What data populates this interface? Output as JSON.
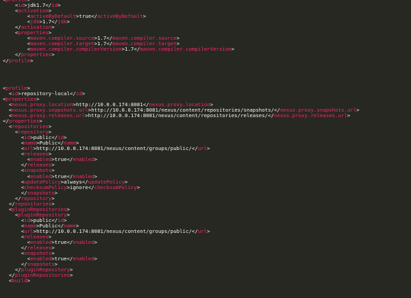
{
  "colors": {
    "background": "#272822",
    "tag": "#f92672",
    "text": "#f8f8f2"
  },
  "lines": [
    [
      0,
      [
        [
          "p",
          "<"
        ],
        [
          "t",
          "profile"
        ],
        [
          "p",
          ">"
        ]
      ]
    ],
    [
      4,
      [
        [
          "p",
          "<"
        ],
        [
          "t",
          "id"
        ],
        [
          "p",
          ">"
        ],
        [
          "x",
          "jdk1.7"
        ],
        [
          "p",
          "</"
        ],
        [
          "t",
          "id"
        ],
        [
          "p",
          ">"
        ]
      ]
    ],
    [
      4,
      [
        [
          "p",
          "<"
        ],
        [
          "t",
          "activation"
        ],
        [
          "p",
          ">"
        ]
      ]
    ],
    [
      8,
      [
        [
          "p",
          "<"
        ],
        [
          "t",
          "activeByDefault"
        ],
        [
          "p",
          ">"
        ],
        [
          "x",
          "true"
        ],
        [
          "p",
          "</"
        ],
        [
          "t",
          "activeByDefault"
        ],
        [
          "p",
          ">"
        ]
      ]
    ],
    [
      8,
      [
        [
          "p",
          "<"
        ],
        [
          "t",
          "jdk"
        ],
        [
          "p",
          ">"
        ],
        [
          "x",
          "1.7"
        ],
        [
          "p",
          "</"
        ],
        [
          "t",
          "jdk"
        ],
        [
          "p",
          ">"
        ]
      ]
    ],
    [
      4,
      [
        [
          "p",
          "</"
        ],
        [
          "t",
          "activation"
        ],
        [
          "p",
          ">"
        ]
      ]
    ],
    [
      4,
      [
        [
          "p",
          "<"
        ],
        [
          "t",
          "properties"
        ],
        [
          "p",
          ">"
        ]
      ]
    ],
    [
      8,
      [
        [
          "p",
          "<"
        ],
        [
          "t",
          "maven.compiler.source"
        ],
        [
          "p",
          ">"
        ],
        [
          "x",
          "1.7"
        ],
        [
          "p",
          "</"
        ],
        [
          "t",
          "maven.compiler.source"
        ],
        [
          "p",
          ">"
        ]
      ]
    ],
    [
      8,
      [
        [
          "p",
          "<"
        ],
        [
          "t",
          "maven.compiler.target"
        ],
        [
          "p",
          ">"
        ],
        [
          "x",
          "1.7"
        ],
        [
          "p",
          "</"
        ],
        [
          "t",
          "maven.compiler.target"
        ],
        [
          "p",
          ">"
        ]
      ]
    ],
    [
      8,
      [
        [
          "p",
          "<"
        ],
        [
          "t",
          "maven.compiler.compilerVersion"
        ],
        [
          "p",
          ">"
        ],
        [
          "x",
          "1.7"
        ],
        [
          "p",
          "</"
        ],
        [
          "t",
          "maven.compiler.compilerVersion"
        ],
        [
          "p",
          ">"
        ]
      ]
    ],
    [
      4,
      [
        [
          "p",
          "</"
        ],
        [
          "t",
          "properties"
        ],
        [
          "p",
          ">"
        ]
      ]
    ],
    [
      0,
      [
        [
          "p",
          "</"
        ],
        [
          "t",
          "profile"
        ],
        [
          "p",
          ">"
        ]
      ]
    ],
    [
      0,
      []
    ],
    [
      0,
      []
    ],
    [
      0,
      []
    ],
    [
      0,
      []
    ],
    [
      0,
      [
        [
          "p",
          "<"
        ],
        [
          "t",
          "profile"
        ],
        [
          "p",
          ">"
        ]
      ]
    ],
    [
      2,
      [
        [
          "p",
          "<"
        ],
        [
          "t",
          "id"
        ],
        [
          "p",
          ">"
        ],
        [
          "x",
          "repository-local"
        ],
        [
          "p",
          "</"
        ],
        [
          "t",
          "id"
        ],
        [
          "p",
          ">"
        ]
      ]
    ],
    [
      0,
      [
        [
          "p",
          "<"
        ],
        [
          "t",
          "properties"
        ],
        [
          "p",
          ">"
        ]
      ]
    ],
    [
      2,
      [
        [
          "p",
          "<"
        ],
        [
          "t",
          "nexus.proxy.location"
        ],
        [
          "p",
          ">"
        ],
        [
          "x",
          "http://10.0.0.174:8081"
        ],
        [
          "p",
          "</"
        ],
        [
          "t",
          "nexus.proxy.location"
        ],
        [
          "p",
          ">"
        ]
      ]
    ],
    [
      2,
      [
        [
          "p",
          "<"
        ],
        [
          "t",
          "nexus.proxy.snapshots.url"
        ],
        [
          "p",
          ">"
        ],
        [
          "x",
          "http://10.0.0.174:8081/nexus/content/repositories/snapshots/"
        ],
        [
          "p",
          "</"
        ],
        [
          "t",
          "nexus.proxy.snapshots.url"
        ],
        [
          "p",
          ">"
        ]
      ]
    ],
    [
      2,
      [
        [
          "p",
          "<"
        ],
        [
          "t",
          "nexus.proxy.releases.url"
        ],
        [
          "p",
          ">"
        ],
        [
          "x",
          "http://10.0.0.174:8081/nexus/content/repositories/releases/"
        ],
        [
          "p",
          "</"
        ],
        [
          "t",
          "nexus.proxy.releases.url"
        ],
        [
          "p",
          ">"
        ]
      ]
    ],
    [
      0,
      [
        [
          "p",
          "</"
        ],
        [
          "t",
          "properties"
        ],
        [
          "p",
          ">"
        ]
      ]
    ],
    [
      2,
      [
        [
          "p",
          "<"
        ],
        [
          "t",
          "repositories"
        ],
        [
          "p",
          ">"
        ]
      ]
    ],
    [
      4,
      [
        [
          "p",
          "<"
        ],
        [
          "t",
          "repository"
        ],
        [
          "p",
          ">"
        ]
      ]
    ],
    [
      6,
      [
        [
          "p",
          "<"
        ],
        [
          "t",
          "id"
        ],
        [
          "p",
          ">"
        ],
        [
          "x",
          "public"
        ],
        [
          "p",
          "</"
        ],
        [
          "t",
          "id"
        ],
        [
          "p",
          ">"
        ]
      ]
    ],
    [
      6,
      [
        [
          "p",
          "<"
        ],
        [
          "t",
          "name"
        ],
        [
          "p",
          ">"
        ],
        [
          "x",
          "Public"
        ],
        [
          "p",
          "</"
        ],
        [
          "t",
          "name"
        ],
        [
          "p",
          ">"
        ]
      ]
    ],
    [
      6,
      [
        [
          "p",
          "<"
        ],
        [
          "t",
          "url"
        ],
        [
          "p",
          ">"
        ],
        [
          "x",
          "http://10.0.0.174:8081/nexus/content/groups/public/"
        ],
        [
          "p",
          "</"
        ],
        [
          "t",
          "url"
        ],
        [
          "p",
          ">"
        ]
      ]
    ],
    [
      6,
      [
        [
          "p",
          "<"
        ],
        [
          "t",
          "releases"
        ],
        [
          "p",
          ">"
        ]
      ]
    ],
    [
      8,
      [
        [
          "p",
          "<"
        ],
        [
          "t",
          "enabled"
        ],
        [
          "p",
          ">"
        ],
        [
          "x",
          "true"
        ],
        [
          "p",
          "</"
        ],
        [
          "t",
          "enabled"
        ],
        [
          "p",
          ">"
        ]
      ]
    ],
    [
      6,
      [
        [
          "p",
          "</"
        ],
        [
          "t",
          "releases"
        ],
        [
          "p",
          ">"
        ]
      ]
    ],
    [
      6,
      [
        [
          "p",
          "<"
        ],
        [
          "t",
          "snapshots"
        ],
        [
          "p",
          ">"
        ]
      ]
    ],
    [
      8,
      [
        [
          "p",
          "<"
        ],
        [
          "t",
          "enabled"
        ],
        [
          "p",
          ">"
        ],
        [
          "x",
          "true"
        ],
        [
          "p",
          "</"
        ],
        [
          "t",
          "enabled"
        ],
        [
          "p",
          ">"
        ]
      ]
    ],
    [
      6,
      [
        [
          "p",
          "<"
        ],
        [
          "t",
          "updatePolicy"
        ],
        [
          "p",
          ">"
        ],
        [
          "x",
          "always"
        ],
        [
          "p",
          "</"
        ],
        [
          "t",
          "updatePolicy"
        ],
        [
          "p",
          ">"
        ]
      ]
    ],
    [
      6,
      [
        [
          "p",
          "<"
        ],
        [
          "t",
          "checksumPolicy"
        ],
        [
          "p",
          ">"
        ],
        [
          "x",
          "ignore"
        ],
        [
          "p",
          "</"
        ],
        [
          "t",
          "checksumPolicy"
        ],
        [
          "p",
          ">"
        ]
      ]
    ],
    [
      6,
      [
        [
          "p",
          "</"
        ],
        [
          "t",
          "snapshots"
        ],
        [
          "p",
          ">"
        ]
      ]
    ],
    [
      4,
      [
        [
          "p",
          "</"
        ],
        [
          "t",
          "repository"
        ],
        [
          "p",
          ">"
        ]
      ]
    ],
    [
      2,
      [
        [
          "p",
          "</"
        ],
        [
          "t",
          "repositories"
        ],
        [
          "p",
          ">"
        ]
      ]
    ],
    [
      2,
      [
        [
          "p",
          "<"
        ],
        [
          "t",
          "pluginRepositories"
        ],
        [
          "p",
          ">"
        ]
      ]
    ],
    [
      4,
      [
        [
          "p",
          "<"
        ],
        [
          "t",
          "pluginRepository"
        ],
        [
          "p",
          ">"
        ]
      ]
    ],
    [
      6,
      [
        [
          "p",
          "<"
        ],
        [
          "t",
          "id"
        ],
        [
          "p",
          ">"
        ],
        [
          "x",
          "public"
        ],
        [
          "p",
          "</"
        ],
        [
          "t",
          "id"
        ],
        [
          "p",
          ">"
        ]
      ]
    ],
    [
      6,
      [
        [
          "p",
          "<"
        ],
        [
          "t",
          "name"
        ],
        [
          "p",
          ">"
        ],
        [
          "x",
          "Public"
        ],
        [
          "p",
          "</"
        ],
        [
          "t",
          "name"
        ],
        [
          "p",
          ">"
        ]
      ]
    ],
    [
      6,
      [
        [
          "p",
          "<"
        ],
        [
          "t",
          "url"
        ],
        [
          "p",
          ">"
        ],
        [
          "x",
          "http://10.0.0.174:8081/nexus/content/groups/public/"
        ],
        [
          "p",
          "</"
        ],
        [
          "t",
          "url"
        ],
        [
          "p",
          ">"
        ]
      ]
    ],
    [
      6,
      [
        [
          "p",
          "<"
        ],
        [
          "t",
          "releases"
        ],
        [
          "p",
          ">"
        ]
      ]
    ],
    [
      8,
      [
        [
          "p",
          "<"
        ],
        [
          "t",
          "enabled"
        ],
        [
          "p",
          ">"
        ],
        [
          "x",
          "true"
        ],
        [
          "p",
          "</"
        ],
        [
          "t",
          "enabled"
        ],
        [
          "p",
          ">"
        ]
      ]
    ],
    [
      6,
      [
        [
          "p",
          "</"
        ],
        [
          "t",
          "releases"
        ],
        [
          "p",
          ">"
        ]
      ]
    ],
    [
      6,
      [
        [
          "p",
          "<"
        ],
        [
          "t",
          "snapshots"
        ],
        [
          "p",
          ">"
        ]
      ]
    ],
    [
      8,
      [
        [
          "p",
          "<"
        ],
        [
          "t",
          "enabled"
        ],
        [
          "p",
          ">"
        ],
        [
          "x",
          "true"
        ],
        [
          "p",
          "</"
        ],
        [
          "t",
          "enabled"
        ],
        [
          "p",
          ">"
        ]
      ]
    ],
    [
      6,
      [
        [
          "p",
          "</"
        ],
        [
          "t",
          "snapshots"
        ],
        [
          "p",
          ">"
        ]
      ]
    ],
    [
      4,
      [
        [
          "p",
          "</"
        ],
        [
          "t",
          "pluginRepository"
        ],
        [
          "p",
          ">"
        ]
      ]
    ],
    [
      2,
      [
        [
          "p",
          "</"
        ],
        [
          "t",
          "pluginRepositories"
        ],
        [
          "p",
          ">"
        ]
      ]
    ],
    [
      2,
      [
        [
          "p",
          "<"
        ],
        [
          "t",
          "build"
        ],
        [
          "p",
          ">"
        ]
      ]
    ]
  ]
}
